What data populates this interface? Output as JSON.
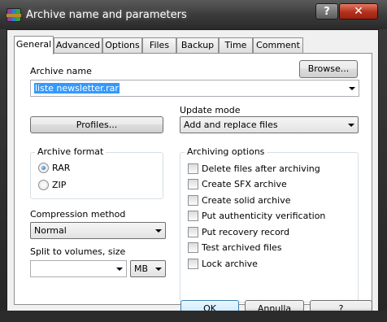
{
  "window": {
    "title": "Archive name and parameters",
    "help_label": "?",
    "close_label": "✕"
  },
  "tabs": [
    "General",
    "Advanced",
    "Options",
    "Files",
    "Backup",
    "Time",
    "Comment"
  ],
  "active_tab": "General",
  "general": {
    "archive_name_label": "Archive name",
    "browse_label": "Browse...",
    "archive_name_value": "liste newsletter.rar",
    "update_mode_label": "Update mode",
    "update_mode_value": "Add and replace files",
    "profiles_label": "Profiles...",
    "archive_format": {
      "title": "Archive format",
      "options": [
        "RAR",
        "ZIP"
      ],
      "selected": "RAR"
    },
    "archiving_options": {
      "title": "Archiving options",
      "items": [
        {
          "label": "Delete files after archiving",
          "checked": false
        },
        {
          "label": "Create SFX archive",
          "checked": false
        },
        {
          "label": "Create solid archive",
          "checked": false
        },
        {
          "label": "Put authenticity verification",
          "checked": false
        },
        {
          "label": "Put recovery record",
          "checked": false
        },
        {
          "label": "Test archived files",
          "checked": false
        },
        {
          "label": "Lock archive",
          "checked": false
        }
      ]
    },
    "compression_method_label": "Compression method",
    "compression_method_value": "Normal",
    "split_label": "Split to volumes, size",
    "split_value": "",
    "split_unit": "MB"
  },
  "footer": {
    "ok_label": "OK",
    "cancel_label": "Annulla",
    "help_label": "?"
  },
  "colors": {
    "selection": "#3399ff",
    "close_button": "#b3301b"
  }
}
